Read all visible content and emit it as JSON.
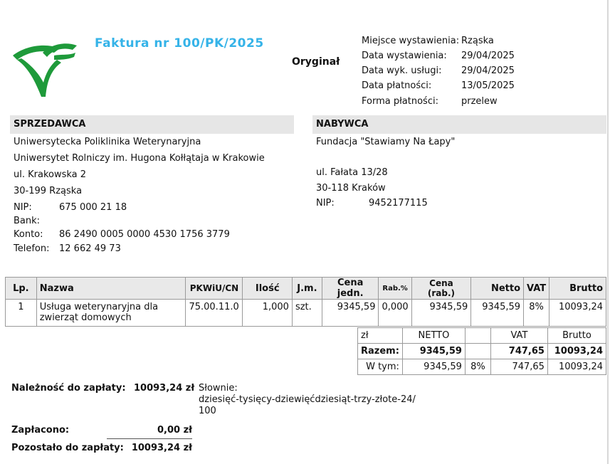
{
  "invoice": {
    "title": "Faktura nr 100/PK/2025",
    "original_label": "Oryginał"
  },
  "meta": [
    {
      "label": "Miejsce wystawienia:",
      "value": "Rząska"
    },
    {
      "label": "Data wystawienia:",
      "value": "29/04/2025"
    },
    {
      "label": "Data wyk. usługi:",
      "value": "29/04/2025"
    },
    {
      "label": "Data płatności:",
      "value": "13/05/2025"
    },
    {
      "label": "Forma płatności:",
      "value": "przelew"
    }
  ],
  "seller": {
    "heading": "SPRZEDAWCA",
    "name1": "Uniwersytecka Poliklinika Weterynaryjna",
    "name2": "Uniwersytet Rolniczy im. Hugona Kołłątaja w Krakowie",
    "street": "ul. Krakowska 2",
    "city": "30-199 Rząska",
    "nip_label": "NIP:",
    "nip": "675 000 21 18",
    "bank_label": "Bank:",
    "account_label": "Konto:",
    "account": "86 2490 0005 0000 4530 1756 3779",
    "phone_label": "Telefon:",
    "phone": "12 662 49 73"
  },
  "buyer": {
    "heading": "NABYWCA",
    "name": "Fundacja \"Stawiamy Na Łapy\"",
    "street": "ul. Fałata 13/28",
    "city": "30-118 Kraków",
    "nip_label": "NIP:",
    "nip": "9452177115"
  },
  "items_table": {
    "headers": {
      "lp": "Lp.",
      "name": "Nazwa",
      "pkwiu": "PKWiU/CN",
      "qty": "Ilość",
      "unit": "J.m.",
      "unit_price": "Cena jedn.",
      "discount": "Rab.%",
      "price_disc": "Cena (rab.)",
      "net": "Netto",
      "vat": "VAT",
      "gross": "Brutto"
    },
    "rows": [
      {
        "lp": "1",
        "name": "Usługa weterynaryjna dla zwierząt domowych",
        "pkwiu": "75.00.11.0",
        "qty": "1,000",
        "unit": "szt.",
        "unit_price": "9345,59",
        "discount": "0,000",
        "price_disc": "9345,59",
        "net": "9345,59",
        "vat": "8%",
        "gross": "10093,24"
      }
    ]
  },
  "summary": {
    "currency": "zł",
    "h_net": "NETTO",
    "h_vat": "VAT",
    "h_gross": "Brutto",
    "total_label": "Razem:",
    "total_net": "9345,59",
    "total_vat": "747,65",
    "total_gross": "10093,24",
    "incl_label": "W tym:",
    "incl_net": "9345,59",
    "incl_rate": "8%",
    "incl_vat": "747,65",
    "incl_gross": "10093,24"
  },
  "payment": {
    "due_label": "Należność do zapłaty:",
    "due_value": "10093,24 zł",
    "words_label": "Słownie:",
    "words_line1": "dziesięć-tysięcy-dziewięćdziesiąt-trzy-złote-24/",
    "words_line2": "100",
    "paid_label": "Zapłacono:",
    "paid_value": "0,00 zł",
    "remaining_label": "Pozostało do zapłaty:",
    "remaining_value": "10093,24 zł"
  },
  "colors": {
    "title": "#35b3e8",
    "logo_green": "#1e9a3a",
    "header_gray": "#e6e6e6"
  }
}
